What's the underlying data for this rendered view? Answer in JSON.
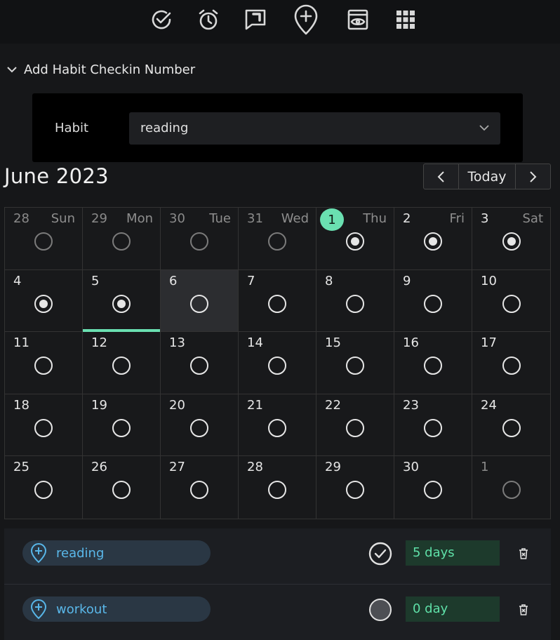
{
  "toolbar": {
    "icons": [
      "check-circle-icon",
      "alarm-icon",
      "comment-icon",
      "map-marker-plus-icon",
      "preview-icon",
      "apps-grid-icon"
    ]
  },
  "section": {
    "title": "Add Habit Checkin Number"
  },
  "form": {
    "habit_label": "Habit",
    "habit_value": "reading"
  },
  "calendar": {
    "month_title": "June 2023",
    "today_label": "Today",
    "accent_color": "#6ae0b1",
    "weekdays": [
      "Sun",
      "Mon",
      "Tue",
      "Wed",
      "Thu",
      "Fri",
      "Sat"
    ],
    "days": [
      {
        "d": "28",
        "other": true,
        "state": "dim"
      },
      {
        "d": "29",
        "other": true,
        "state": "dim"
      },
      {
        "d": "30",
        "other": true,
        "state": "dim"
      },
      {
        "d": "31",
        "other": true,
        "state": "dim"
      },
      {
        "d": "1",
        "today": true,
        "state": "done"
      },
      {
        "d": "2",
        "state": "done"
      },
      {
        "d": "3",
        "state": "done"
      },
      {
        "d": "4",
        "state": "done"
      },
      {
        "d": "5",
        "state": "done",
        "underline": true
      },
      {
        "d": "6",
        "state": "empty",
        "selected": true
      },
      {
        "d": "7",
        "state": "empty"
      },
      {
        "d": "8",
        "state": "empty"
      },
      {
        "d": "9",
        "state": "empty"
      },
      {
        "d": "10",
        "state": "empty"
      },
      {
        "d": "11",
        "state": "empty"
      },
      {
        "d": "12",
        "state": "empty"
      },
      {
        "d": "13",
        "state": "empty"
      },
      {
        "d": "14",
        "state": "empty"
      },
      {
        "d": "15",
        "state": "empty"
      },
      {
        "d": "16",
        "state": "empty"
      },
      {
        "d": "17",
        "state": "empty"
      },
      {
        "d": "18",
        "state": "empty"
      },
      {
        "d": "19",
        "state": "empty"
      },
      {
        "d": "20",
        "state": "empty"
      },
      {
        "d": "21",
        "state": "empty"
      },
      {
        "d": "22",
        "state": "empty"
      },
      {
        "d": "23",
        "state": "empty"
      },
      {
        "d": "24",
        "state": "empty"
      },
      {
        "d": "25",
        "state": "empty"
      },
      {
        "d": "26",
        "state": "empty"
      },
      {
        "d": "27",
        "state": "empty"
      },
      {
        "d": "28",
        "state": "empty"
      },
      {
        "d": "29",
        "state": "empty"
      },
      {
        "d": "30",
        "state": "empty"
      },
      {
        "d": "1",
        "other": true,
        "state": "dim"
      }
    ]
  },
  "habits": [
    {
      "name": "reading",
      "streak": "5 days",
      "status": "checked"
    },
    {
      "name": "workout",
      "streak": "0 day",
      "status": "unchecked"
    }
  ]
}
